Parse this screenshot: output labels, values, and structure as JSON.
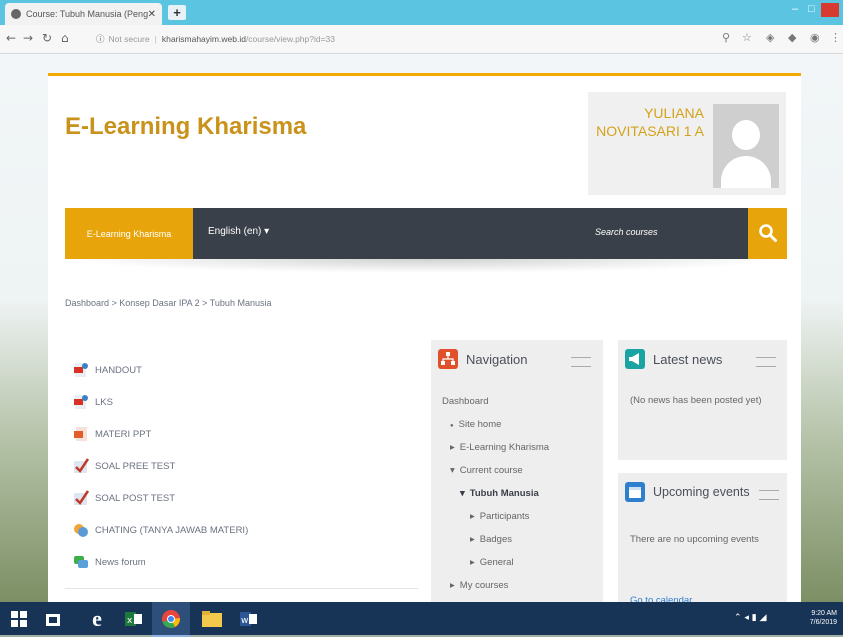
{
  "browser": {
    "tab_title": "Course: Tubuh Manusia (Pengs...",
    "url_secure_label": "Not secure",
    "url_host": "kharismahayim.web.id",
    "url_path": "/course/view.php?id=33"
  },
  "site": {
    "title": "E-Learning Kharisma",
    "user_name_line1": "YULIANA",
    "user_name_line2": "NOVITASARI 1 A"
  },
  "navbar": {
    "home_label": "E-Learning Kharisma",
    "language_label": "English (en) ▾",
    "search_label": "Search courses"
  },
  "breadcrumb": "Dashboard > Konsep Dasar IPA 2 > Tubuh Manusia",
  "activities": [
    {
      "label": "HANDOUT",
      "icon": "pdf-icon"
    },
    {
      "label": "LKS",
      "icon": "pdf-icon"
    },
    {
      "label": "MATERI PPT",
      "icon": "ppt-icon"
    },
    {
      "label": "SOAL PREE TEST",
      "icon": "quiz-icon"
    },
    {
      "label": "SOAL POST TEST",
      "icon": "quiz-icon"
    },
    {
      "label": "CHATING (TANYA JAWAB MATERI)",
      "icon": "chat-icon"
    },
    {
      "label": "News forum",
      "icon": "forum-icon"
    }
  ],
  "blocks": {
    "navigation": {
      "title": "Navigation",
      "items": [
        {
          "label": "Dashboard",
          "prefix": ""
        },
        {
          "label": "Site home",
          "prefix": "●"
        },
        {
          "label": "E-Learning Kharisma",
          "prefix": "▸"
        },
        {
          "label": "Current course",
          "prefix": "▾"
        },
        {
          "label": "Tubuh Manusia",
          "prefix": "▾"
        },
        {
          "label": "Participants",
          "prefix": "▸"
        },
        {
          "label": "Badges",
          "prefix": "▸"
        },
        {
          "label": "General",
          "prefix": "▸"
        },
        {
          "label": "My courses",
          "prefix": "▸"
        }
      ]
    },
    "latest_news": {
      "title": "Latest news",
      "text": "(No news has been posted yet)"
    },
    "upcoming_events": {
      "title": "Upcoming events",
      "text": "There are no upcoming events",
      "link": "Go to calendar..."
    }
  },
  "taskbar": {
    "time": "9:20 AM",
    "date": "7/6/2019"
  },
  "colors": {
    "accent": "#e8a50b",
    "navbar_bg": "#3a404a",
    "title": "#c9921a",
    "taskbar": "#173457"
  }
}
